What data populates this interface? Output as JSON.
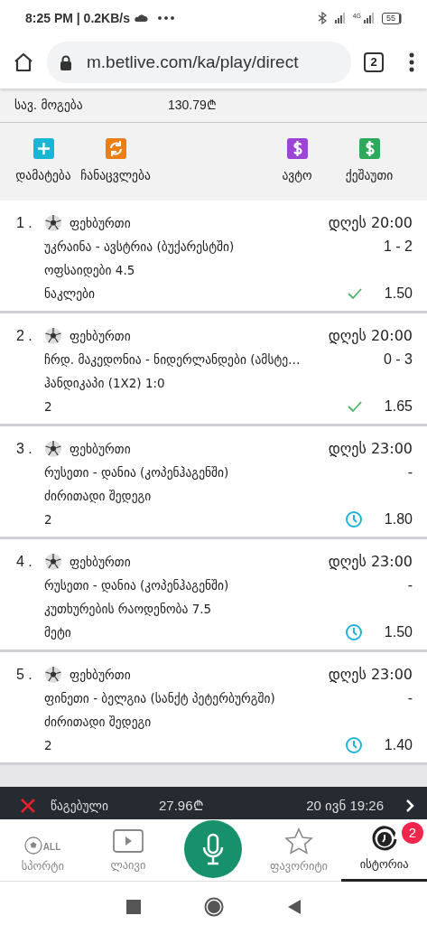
{
  "status_bar": {
    "time": "8:25 PM | 0.2KB/s",
    "network_label": "4G",
    "battery": "55"
  },
  "browser": {
    "url": "m.betlive.com/ka/play/direct",
    "tab_count": "2"
  },
  "summary": {
    "label": "სავ. მოგება",
    "amount": "130.79₾"
  },
  "actions": [
    {
      "label": "დამატება",
      "kind": "add",
      "color": "#17b6d3"
    },
    {
      "label": "ჩანაცვლება",
      "kind": "swap",
      "color": "#ee7d12"
    },
    {
      "label": "ავტო",
      "kind": "dollar",
      "color": "#9b44d6"
    },
    {
      "label": "ქეშაუთი",
      "kind": "dollar",
      "color": "#2ea85a"
    }
  ],
  "bets": [
    {
      "number": "1 .",
      "sport": "ფეხბურთი",
      "time": "დღეს 20:00",
      "match": "უკრაინა - ავსტრია (ბუქარესტში)",
      "score": "1 - 2",
      "market": "ოფსაიდები 4.5",
      "pick": "ნაკლები",
      "kind": "won",
      "odds": "1.50"
    },
    {
      "number": "2 .",
      "sport": "ფეხბურთი",
      "time": "დღეს 20:00",
      "match": "ჩრდ. მაკედონია - ნიდერლანდები (ამსტე…",
      "score": "0 - 3",
      "market": "ჰანდიკაპი (1X2) 1:0",
      "pick": "2",
      "kind": "won",
      "odds": "1.65"
    },
    {
      "number": "3 .",
      "sport": "ფეხბურთი",
      "time": "დღეს 23:00",
      "match": "რუსეთი - დანია (კოპენჰაგენში)",
      "score": "-",
      "market": "ძირითადი შედეგი",
      "pick": "2",
      "kind": "pending",
      "odds": "1.80"
    },
    {
      "number": "4 .",
      "sport": "ფეხბურთი",
      "time": "დღეს 23:00",
      "match": "რუსეთი - დანია (კოპენჰაგენში)",
      "score": "-",
      "market": "კუთხურების რაოდენობა 7.5",
      "pick": "მეტი",
      "kind": "pending",
      "odds": "1.50"
    },
    {
      "number": "5 .",
      "sport": "ფეხბურთი",
      "time": "დღეს 23:00",
      "match": "ფინეთი - ბელგია (სანქტ პეტერბურგში)",
      "score": "-",
      "market": "ძირითადი შედეგი",
      "pick": "2",
      "kind": "pending",
      "odds": "1.40"
    }
  ],
  "ticket_bar": {
    "lost": true,
    "result": "წაგებული",
    "amount": "27.96₾",
    "date": "20 ივნ 19:26"
  },
  "bottom_nav": [
    {
      "label": "სპორტი",
      "kind": "sports",
      "icon_text": "ALL",
      "selected": false
    },
    {
      "label": "ლაივი",
      "kind": "live",
      "selected": false
    },
    {
      "kind": "mic",
      "selected": false
    },
    {
      "label": "ფავორიტი",
      "kind": "star",
      "selected": false
    },
    {
      "label": "ისტორია",
      "kind": "history",
      "badge": "2",
      "selected": true
    }
  ]
}
